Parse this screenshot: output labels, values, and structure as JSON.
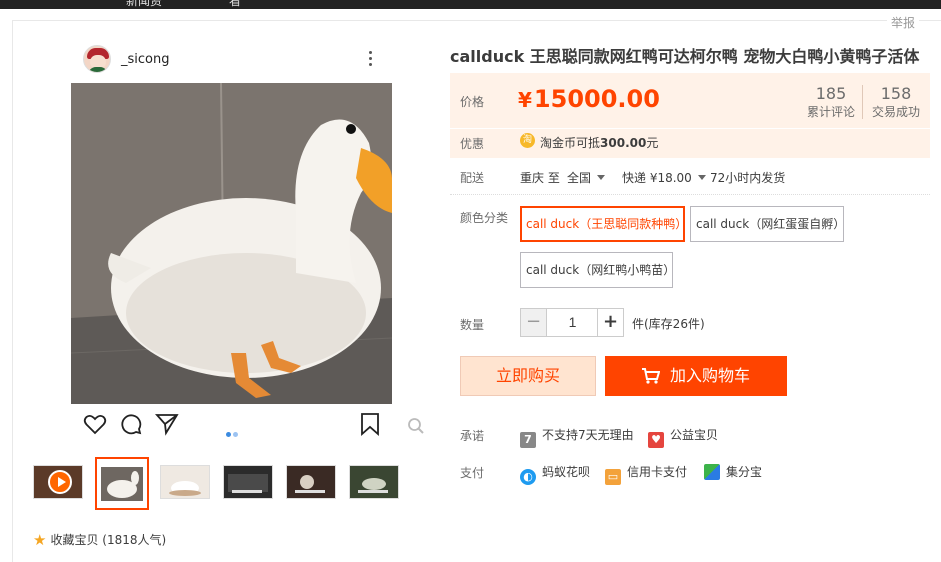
{
  "topbar": {
    "items": [
      "新闻资",
      "看"
    ]
  },
  "report_label": "举报",
  "post": {
    "username": "_sicong"
  },
  "product": {
    "title": "callduck 王思聪同款网红鸭可达柯尔鸭 宠物大白鸭小黄鸭子活体",
    "price_label": "价格",
    "currency": "¥",
    "price": "15000.00",
    "reviews_count": "185",
    "reviews_label": "累计评论",
    "sales_count": "158",
    "sales_label": "交易成功",
    "promo_label": "优惠",
    "coin_glyph": "淘",
    "promo_text_prefix": "淘金币可抵",
    "promo_amount": "300.00",
    "promo_unit": "元"
  },
  "shipping": {
    "label": "配送",
    "from": "重庆 至",
    "to": "全国",
    "express": "快递 ¥18.00",
    "dispatch": "72小时内发货"
  },
  "sku": {
    "label": "颜色分类",
    "options": [
      {
        "label": "call duck（王思聪同款种鸭）",
        "selected": true
      },
      {
        "label": "call duck（网红蛋蛋自孵）",
        "selected": false
      },
      {
        "label": "call duck（网红鸭小鸭苗）",
        "selected": false
      }
    ]
  },
  "quantity": {
    "label": "数量",
    "minus": "−",
    "value": "1",
    "plus": "+",
    "stock": "件(库存26件)"
  },
  "actions": {
    "buy_now": "立即购买",
    "add_to_cart": "加入购物车"
  },
  "promise": {
    "label": "承诺",
    "no_return_icon": "7",
    "no_return": "不支持7天无理由",
    "charity": "公益宝贝"
  },
  "payment": {
    "label": "支付",
    "methods": [
      "蚂蚁花呗",
      "信用卡支付",
      "集分宝"
    ]
  },
  "favorite": {
    "label": "收藏宝贝",
    "count": "(1818人气)"
  },
  "colors": {
    "accent": "#ff4400",
    "price_bg": "#fff2e8"
  }
}
